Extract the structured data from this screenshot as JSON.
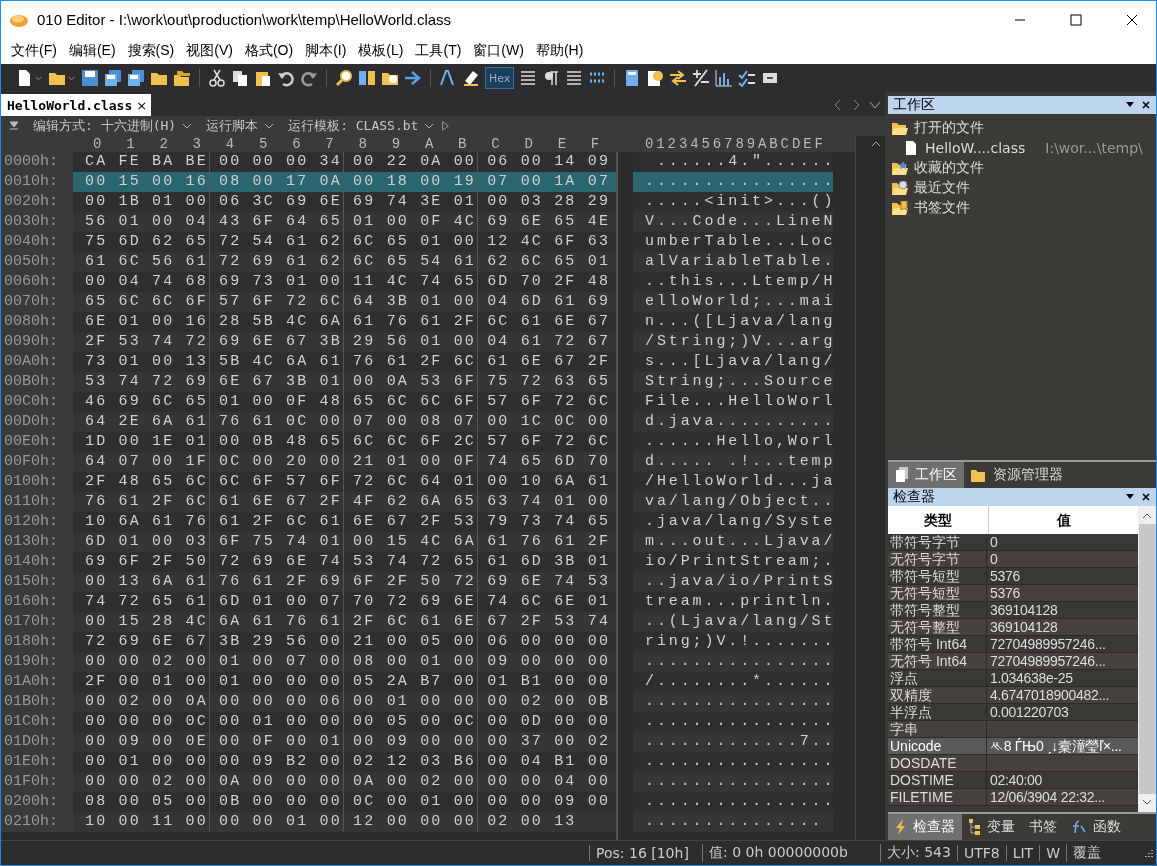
{
  "window": {
    "title": "010 Editor - I:\\work\\out\\production\\work\\temp\\HelloWorld.class"
  },
  "menu": [
    "文件(F)",
    "编辑(E)",
    "搜索(S)",
    "视图(V)",
    "格式(O)",
    "脚本(I)",
    "模板(L)",
    "工具(T)",
    "窗口(W)",
    "帮助(H)"
  ],
  "toolbar": {
    "hex_button": {
      "label": "Hex",
      "selected": true
    }
  },
  "tabs": [
    {
      "label": "HelloWorld.class",
      "close": "×",
      "selected": true
    }
  ],
  "info_bar": {
    "edit_mode": "编辑方式: 十六进制(H)",
    "run_script": "运行脚本",
    "run_template": "运行模板: CLASS.bt"
  },
  "hex": {
    "columns": [
      "0",
      "1",
      "2",
      "3",
      "4",
      "5",
      "6",
      "7",
      "8",
      "9",
      "A",
      "B",
      "C",
      "D",
      "E",
      "F"
    ],
    "ascii_header": "0123456789ABCDEF",
    "rows": [
      {
        "offset": "0000h:",
        "bytes": "CA FE BA BE 00 00 00 34 00 22 0A 00 06 00 14 09",
        "ascii": " ......4.\"......",
        "selected": false
      },
      {
        "offset": "0010h:",
        "bytes": "00 15 00 16 08 00 17 0A 00 18 00 19 07 00 1A 07",
        "ascii": "................",
        "selected": true
      },
      {
        "offset": "0020h:",
        "bytes": "00 1B 01 00 06 3C 69 6E 69 74 3E 01 00 03 28 29",
        "ascii": ".....<init>...()",
        "selected": false
      },
      {
        "offset": "0030h:",
        "bytes": "56 01 00 04 43 6F 64 65 01 00 0F 4C 69 6E 65 4E",
        "ascii": "V...Code...LineN",
        "selected": false
      },
      {
        "offset": "0040h:",
        "bytes": "75 6D 62 65 72 54 61 62 6C 65 01 00 12 4C 6F 63",
        "ascii": "umberTable...Loc",
        "selected": false
      },
      {
        "offset": "0050h:",
        "bytes": "61 6C 56 61 72 69 61 62 6C 65 54 61 62 6C 65 01",
        "ascii": "alVariableTable.",
        "selected": false
      },
      {
        "offset": "0060h:",
        "bytes": "00 04 74 68 69 73 01 00 11 4C 74 65 6D 70 2F 48",
        "ascii": "..this...Ltemp/H",
        "selected": false
      },
      {
        "offset": "0070h:",
        "bytes": "65 6C 6C 6F 57 6F 72 6C 64 3B 01 00 04 6D 61 69",
        "ascii": "elloWorld;...mai",
        "selected": false
      },
      {
        "offset": "0080h:",
        "bytes": "6E 01 00 16 28 5B 4C 6A 61 76 61 2F 6C 61 6E 67",
        "ascii": "n...([Ljava/lang",
        "selected": false
      },
      {
        "offset": "0090h:",
        "bytes": "2F 53 74 72 69 6E 67 3B 29 56 01 00 04 61 72 67",
        "ascii": "/String;)V...arg",
        "selected": false
      },
      {
        "offset": "00A0h:",
        "bytes": "73 01 00 13 5B 4C 6A 61 76 61 2F 6C 61 6E 67 2F",
        "ascii": "s...[Ljava/lang/",
        "selected": false
      },
      {
        "offset": "00B0h:",
        "bytes": "53 74 72 69 6E 67 3B 01 00 0A 53 6F 75 72 63 65",
        "ascii": "String;...Source",
        "selected": false
      },
      {
        "offset": "00C0h:",
        "bytes": "46 69 6C 65 01 00 0F 48 65 6C 6C 6F 57 6F 72 6C",
        "ascii": "File...HelloWorl",
        "selected": false
      },
      {
        "offset": "00D0h:",
        "bytes": "64 2E 6A 61 76 61 0C 00 07 00 08 07 00 1C 0C 00",
        "ascii": "d.java..........",
        "selected": false
      },
      {
        "offset": "00E0h:",
        "bytes": "1D 00 1E 01 00 0B 48 65 6C 6C 6F 2C 57 6F 72 6C",
        "ascii": "......Hello,Worl",
        "selected": false
      },
      {
        "offset": "00F0h:",
        "bytes": "64 07 00 1F 0C 00 20 00 21 01 00 0F 74 65 6D 70",
        "ascii": "d..... .!...temp",
        "selected": false
      },
      {
        "offset": "0100h:",
        "bytes": "2F 48 65 6C 6C 6F 57 6F 72 6C 64 01 00 10 6A 61",
        "ascii": "/HelloWorld...ja",
        "selected": false
      },
      {
        "offset": "0110h:",
        "bytes": "76 61 2F 6C 61 6E 67 2F 4F 62 6A 65 63 74 01 00",
        "ascii": "va/lang/Object..",
        "selected": false
      },
      {
        "offset": "0120h:",
        "bytes": "10 6A 61 76 61 2F 6C 61 6E 67 2F 53 79 73 74 65",
        "ascii": ".java/lang/Syste",
        "selected": false
      },
      {
        "offset": "0130h:",
        "bytes": "6D 01 00 03 6F 75 74 01 00 15 4C 6A 61 76 61 2F",
        "ascii": "m...out...Ljava/",
        "selected": false
      },
      {
        "offset": "0140h:",
        "bytes": "69 6F 2F 50 72 69 6E 74 53 74 72 65 61 6D 3B 01",
        "ascii": "io/PrintStream;.",
        "selected": false
      },
      {
        "offset": "0150h:",
        "bytes": "00 13 6A 61 76 61 2F 69 6F 2F 50 72 69 6E 74 53",
        "ascii": "..java/io/PrintS",
        "selected": false
      },
      {
        "offset": "0160h:",
        "bytes": "74 72 65 61 6D 01 00 07 70 72 69 6E 74 6C 6E 01",
        "ascii": "tream...println.",
        "selected": false
      },
      {
        "offset": "0170h:",
        "bytes": "00 15 28 4C 6A 61 76 61 2F 6C 61 6E 67 2F 53 74",
        "ascii": "..(Ljava/lang/St",
        "selected": false
      },
      {
        "offset": "0180h:",
        "bytes": "72 69 6E 67 3B 29 56 00 21 00 05 00 06 00 00 00",
        "ascii": "ring;)V.!.......",
        "selected": false
      },
      {
        "offset": "0190h:",
        "bytes": "00 00 02 00 01 00 07 00 08 00 01 00 09 00 00 00",
        "ascii": "................",
        "selected": false
      },
      {
        "offset": "01A0h:",
        "bytes": "2F 00 01 00 01 00 00 00 05 2A B7 00 01 B1 00 00",
        "ascii": "/........*......",
        "selected": false
      },
      {
        "offset": "01B0h:",
        "bytes": "00 02 00 0A 00 00 00 06 00 01 00 00 00 02 00 0B",
        "ascii": "................",
        "selected": false
      },
      {
        "offset": "01C0h:",
        "bytes": "00 00 00 0C 00 01 00 00 00 05 00 0C 00 0D 00 00",
        "ascii": "................",
        "selected": false
      },
      {
        "offset": "01D0h:",
        "bytes": "00 09 00 0E 00 0F 00 01 00 09 00 00 00 37 00 02",
        "ascii": ".............7..",
        "selected": false
      },
      {
        "offset": "01E0h:",
        "bytes": "00 01 00 00 00 09 B2 00 02 12 03 B6 00 04 B1 00",
        "ascii": "................",
        "selected": false
      },
      {
        "offset": "01F0h:",
        "bytes": "00 00 02 00 0A 00 00 00 0A 00 02 00 00 00 04 00",
        "ascii": "................",
        "selected": false
      },
      {
        "offset": "0200h:",
        "bytes": "08 00 05 00 0B 00 00 00 0C 00 01 00 00 00 09 00",
        "ascii": "................",
        "selected": false
      },
      {
        "offset": "0210h:",
        "bytes": "10 00 11 00 00 00 01 00 12 00 00 00 02 00 13",
        "ascii": "...............",
        "selected": false
      }
    ]
  },
  "workspace": {
    "title": "工作区",
    "items": [
      {
        "label": "打开的文件",
        "kind": "open",
        "children": [
          {
            "label": "HelloW....class",
            "path": "I:\\wor...\\temp\\"
          }
        ]
      },
      {
        "label": "收藏的文件",
        "kind": "favorites"
      },
      {
        "label": "最近文件",
        "kind": "recent"
      },
      {
        "label": "书签文件",
        "kind": "bookmarks"
      }
    ],
    "tabs": [
      {
        "label": "工作区",
        "selected": true
      },
      {
        "label": "资源管理器",
        "selected": false
      }
    ]
  },
  "inspector": {
    "title": "检查器",
    "columns": [
      "类型",
      "值"
    ],
    "rows": [
      {
        "type": "带符号字节",
        "value": "0",
        "selected": false
      },
      {
        "type": "无符号字节",
        "value": "0",
        "selected": false
      },
      {
        "type": "带符号短型",
        "value": "5376",
        "selected": false
      },
      {
        "type": "无符号短型",
        "value": "5376",
        "selected": false
      },
      {
        "type": "带符号整型",
        "value": "369104128",
        "selected": false
      },
      {
        "type": "无符号整型",
        "value": "369104128",
        "selected": false
      },
      {
        "type": "带符号 Int64",
        "value": "72704989957246...",
        "selected": false
      },
      {
        "type": "无符号 Int64",
        "value": "72704989957246...",
        "selected": false
      },
      {
        "type": "浮点",
        "value": "1.034638e-25",
        "selected": false
      },
      {
        "type": "双精度",
        "value": "4.6747018900482...",
        "selected": false
      },
      {
        "type": "半浮点",
        "value": "0.001220703",
        "selected": false
      },
      {
        "type": "字串",
        "selected": false
      },
      {
        "type": "Unicode",
        "value": "ᄿ8 ЃЊ0 ˏ↓槖潼瑩ľ×...",
        "selected": true
      },
      {
        "type": "DOSDATE",
        "selected": false
      },
      {
        "type": "DOSTIME",
        "value": "02:40:00",
        "selected": false
      },
      {
        "type": "FILETIME",
        "value": "12/06/3904 22:32...",
        "selected": false
      }
    ],
    "tabs": [
      {
        "label": "检查器",
        "kind": "inspector",
        "selected": true
      },
      {
        "label": "变量",
        "kind": "variables",
        "selected": false
      },
      {
        "label": "书签",
        "kind": "bookmarks",
        "selected": false
      },
      {
        "label": "函数",
        "kind": "functions",
        "selected": false
      }
    ]
  },
  "status_bar": [
    "Pos: 16 [10h]",
    "值: 0 0h 00000000b",
    "大小: 543",
    "UTF8",
    "LIT",
    "W",
    "覆盖"
  ]
}
